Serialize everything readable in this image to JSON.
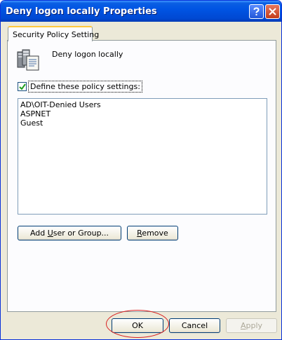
{
  "window": {
    "title": "Deny logon locally Properties",
    "help_glyph": "?",
    "close_glyph": "X"
  },
  "tabs": [
    {
      "label": "Security Policy Setting",
      "active": true
    }
  ],
  "policy": {
    "icon": "server-policy-icon",
    "title": "Deny logon locally"
  },
  "define_checkbox": {
    "label": "Define these policy settings:",
    "checked": true
  },
  "members": [
    "AD\\OIT-Denied Users",
    "ASPNET",
    "Guest"
  ],
  "buttons": {
    "add": {
      "pre": "Add ",
      "key": "U",
      "post": "ser or Group..."
    },
    "remove": {
      "pre": "",
      "key": "R",
      "post": "emove"
    },
    "ok": "OK",
    "cancel": "Cancel",
    "apply": {
      "pre": "",
      "key": "A",
      "post": "pply",
      "enabled": false
    }
  },
  "colors": {
    "titlebar": "#0054e3",
    "dialog_bg": "#ece9d8",
    "tab_highlight": "#ffc83c",
    "annotation": "#d91f1f"
  }
}
